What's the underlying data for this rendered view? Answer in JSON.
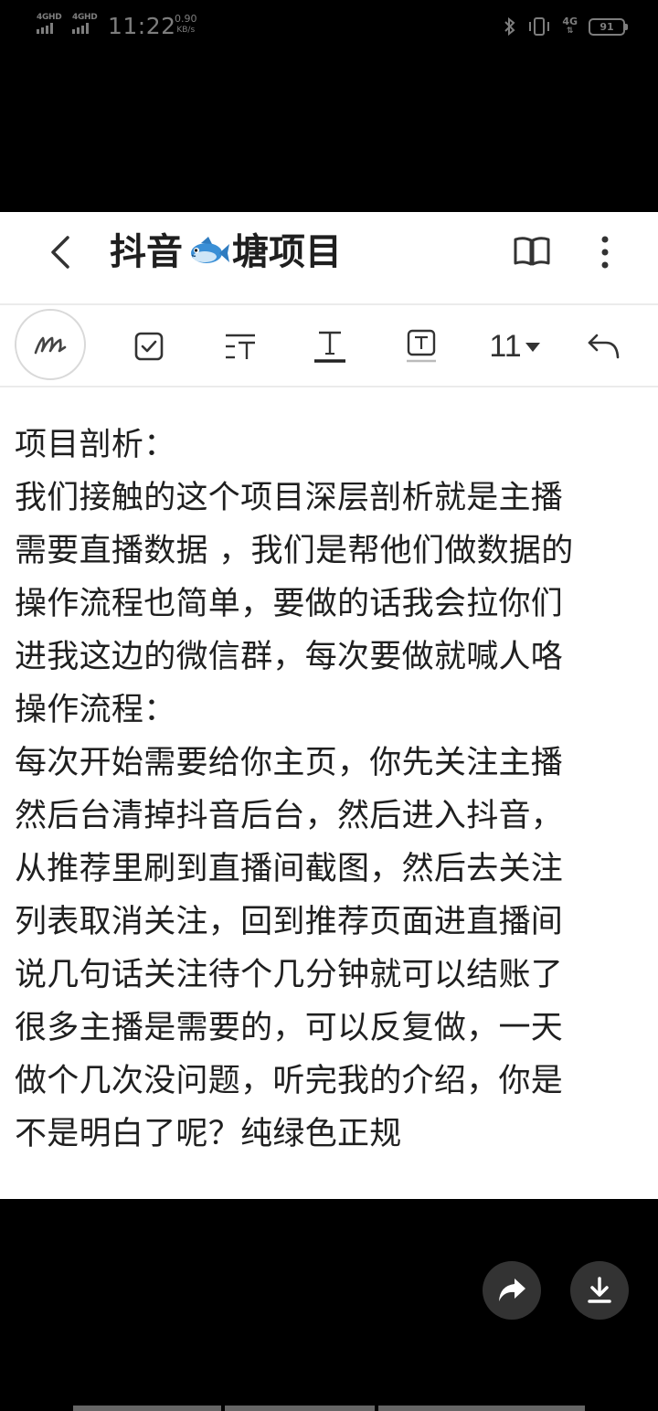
{
  "status_bar": {
    "sim1_label": "4GHD",
    "sim2_label": "4GHD",
    "time": "11:22",
    "speed_value": "0.90",
    "speed_unit": "KB/s",
    "network_right": "4G",
    "battery_level": "91"
  },
  "header": {
    "title_before_icon": "抖音",
    "title_after_icon": "塘项目",
    "title_icon": "fish-icon",
    "back_icon": "back-chevron-icon",
    "reader_icon": "open-book-icon",
    "more_icon": "more-vertical-icon"
  },
  "toolbar": {
    "items": [
      "handwriting-pen-icon",
      "checkbox-icon",
      "text-spacing-icon",
      "text-underline-icon",
      "text-box-icon",
      "font-size-select",
      "undo-icon"
    ],
    "font_size": "11"
  },
  "document": {
    "lines": [
      "项目剖析：",
      "我们接触的这个项目深层剖析就是主播",
      "需要直播数据 ，我们是帮他们做数据的",
      "操作流程也简单，要做的话我会拉你们",
      "进我这边的微信群，每次要做就喊人咯",
      "操作流程：",
      "每次开始需要给你主页，你先关注主播",
      "然后台清掉抖音后台，然后进入抖音，",
      "从推荐里刷到直播间截图，然后去关注",
      "列表取消关注，回到推荐页面进直播间",
      "说几句话关注待个几分钟就可以结账了",
      "很多主播是需要的，可以反复做，一天",
      "做个几次没问题，听完我的介绍，你是",
      "不是明白了呢？纯绿色正规"
    ]
  },
  "floating_actions": {
    "share_icon": "share-arrow-icon",
    "download_icon": "download-icon"
  },
  "colors": {
    "background": "#000000",
    "card": "#ffffff",
    "text": "#1f1f1f",
    "status_text": "#7d7d7d",
    "fab": "#333333"
  }
}
